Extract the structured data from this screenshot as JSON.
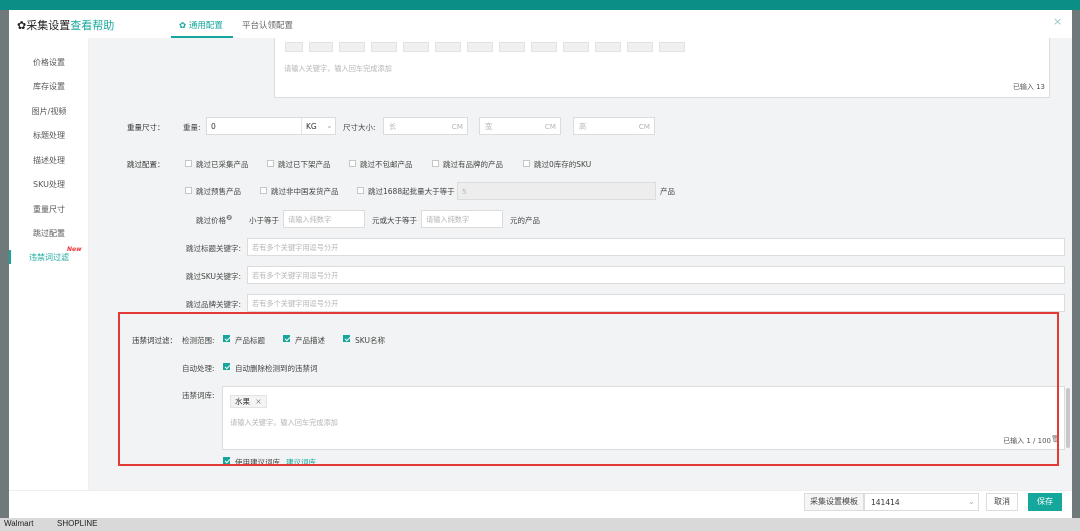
{
  "background": {
    "bottom_tabs": [
      "Walmart",
      "SHOPLINE"
    ]
  },
  "dialog": {
    "title": "✿采集设置",
    "help_link": "查看帮助",
    "tabs": [
      {
        "label": "✿ 通用配置",
        "active": true
      },
      {
        "label": "平台认领配置",
        "active": false
      }
    ],
    "close_icon": "×"
  },
  "sidebar": {
    "items": [
      {
        "label": "价格设置"
      },
      {
        "label": "库存设置"
      },
      {
        "label": "图片/视频"
      },
      {
        "label": "标题处理"
      },
      {
        "label": "描述处理"
      },
      {
        "label": "SKU处理"
      },
      {
        "label": "重量尺寸"
      },
      {
        "label": "跳过配置"
      },
      {
        "label": "违禁词过滤",
        "active": true,
        "badge": "New"
      }
    ]
  },
  "keyword_box": {
    "placeholder": "请输入关键字，输入回车完成添加",
    "count": "已输入 13"
  },
  "weight_size": {
    "section_label": "重量尺寸：",
    "weight_label": "重量:",
    "weight_value": "0",
    "weight_unit": "KG",
    "size_label": "尺寸大小:",
    "length_placeholder": "长",
    "width_placeholder": "宽",
    "height_placeholder": "高",
    "size_unit": "CM"
  },
  "skip_config": {
    "section_label": "跳过配置：",
    "row1": [
      "跳过已采集产品",
      "跳过已下架产品",
      "跳过不包邮产品",
      "跳过有品牌的产品",
      "跳过0库存的SKU"
    ],
    "row2": [
      "跳过预售产品",
      "跳过非中国发货产品",
      "跳过1688起批量大于等于"
    ],
    "moq_value": "5",
    "moq_suffix": "产品",
    "price_label": "跳过价格",
    "price_less": "小于等于",
    "price_placeholder": "请输入纯数字",
    "price_mid": "元或大于等于",
    "price_suffix": "元的产品",
    "title_kw_label": "跳过标题关键字:",
    "sku_kw_label": "跳过SKU关键字:",
    "brand_kw_label": "跳过品牌关键字:",
    "kw_placeholder": "若有多个关键字用逗号分开"
  },
  "forbidden": {
    "section_label": "违禁词过滤：",
    "scope_label": "检测范围:",
    "scope_options": [
      {
        "label": "产品标题",
        "checked": true
      },
      {
        "label": "产品描述",
        "checked": true
      },
      {
        "label": "SKU名称",
        "checked": true
      }
    ],
    "auto_label": "自动处理:",
    "auto_option": "自动删除检测到的违禁词",
    "lib_label": "违禁词库:",
    "tags": [
      "水果"
    ],
    "tag_remove": "×",
    "placeholder": "请输入关键字，输入回车完成添加",
    "count": "已输入 1 / 100",
    "use_suggest": "使用建议词库",
    "suggest_link": "建议词库"
  },
  "footer": {
    "template_label": "采集设置模板",
    "template_value": "141414",
    "cancel": "取消",
    "save": "保存"
  },
  "colors": {
    "accent": "#16a79c",
    "highlight_frame": "#e53935",
    "new_badge": "#e33333"
  }
}
